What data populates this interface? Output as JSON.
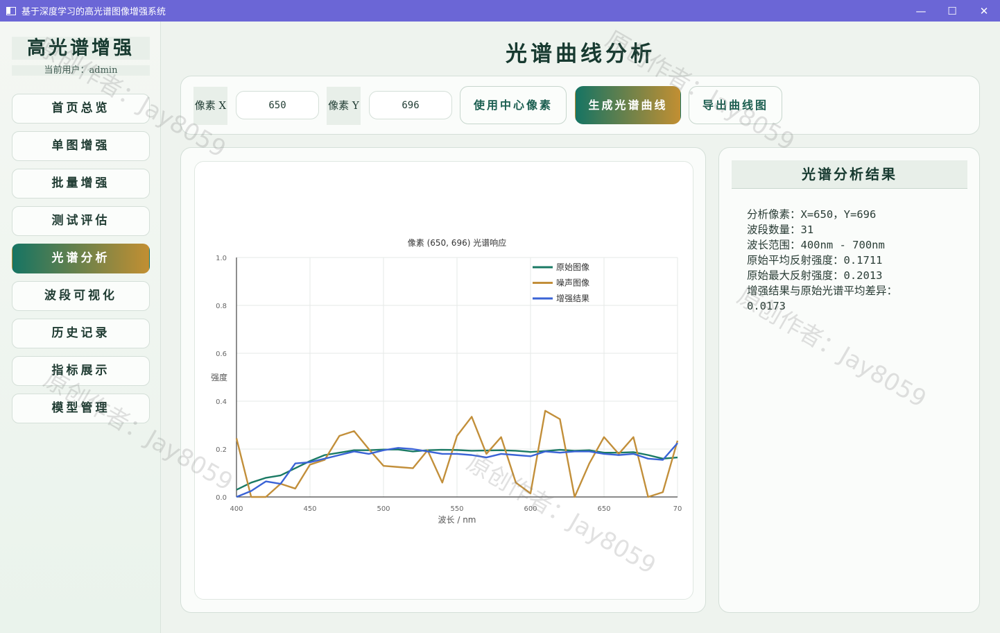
{
  "window": {
    "title": "基于深度学习的高光谱图像增强系统",
    "minimize": "—",
    "maximize": "☐",
    "close": "✕"
  },
  "sidebar": {
    "brand": "高光谱增强",
    "user": "当前用户：admin",
    "items": [
      {
        "label": "首页总览",
        "active": false
      },
      {
        "label": "单图增强",
        "active": false
      },
      {
        "label": "批量增强",
        "active": false
      },
      {
        "label": "测试评估",
        "active": false
      },
      {
        "label": "光谱分析",
        "active": true
      },
      {
        "label": "波段可视化",
        "active": false
      },
      {
        "label": "历史记录",
        "active": false
      },
      {
        "label": "指标展示",
        "active": false
      },
      {
        "label": "模型管理",
        "active": false
      }
    ]
  },
  "page": {
    "title": "光谱曲线分析"
  },
  "toolbar": {
    "x_label": "像素 X",
    "x_value": "650",
    "y_label": "像素 Y",
    "y_value": "696",
    "center_button": "使用中心像素",
    "generate_button": "生成光谱曲线",
    "export_button": "导出曲线图"
  },
  "results": {
    "title": "光谱分析结果",
    "text": "分析像素：X=650，Y=696\n波段数量：31\n波长范围：400nm - 700nm\n原始平均反射强度：0.1711\n原始最大反射强度：0.2013\n增强结果与原始光谱平均差异：\n0.0173"
  },
  "watermark": "原创作者：Jay8059",
  "colors": {
    "original": "#1a7a64",
    "noisy": "#c28f3a",
    "enhanced": "#3a63d6",
    "accent_start": "#167463",
    "accent_end": "#c28f32"
  },
  "chart_data": {
    "type": "line",
    "title": "像素 (650, 696) 光谱响应",
    "xlabel": "波长 / nm",
    "ylabel": "强度",
    "xlim": [
      400,
      700
    ],
    "ylim": [
      0,
      1.0
    ],
    "xticks": [
      "400",
      "450",
      "500",
      "550",
      "600",
      "650",
      "70"
    ],
    "yticks": [
      "0.0",
      "0.2",
      "0.4",
      "0.6",
      "0.8",
      "1.0"
    ],
    "grid": true,
    "legend": "top-right",
    "x": [
      400,
      410,
      420,
      430,
      440,
      450,
      460,
      470,
      480,
      490,
      500,
      510,
      520,
      530,
      540,
      550,
      560,
      570,
      580,
      590,
      600,
      610,
      620,
      630,
      640,
      650,
      660,
      670,
      680,
      690,
      700
    ],
    "series": [
      {
        "name": "原始图像",
        "color": "#1a7a64",
        "values": [
          0.03,
          0.06,
          0.08,
          0.09,
          0.12,
          0.15,
          0.175,
          0.185,
          0.195,
          0.195,
          0.198,
          0.198,
          0.19,
          0.195,
          0.197,
          0.196,
          0.193,
          0.194,
          0.195,
          0.193,
          0.188,
          0.192,
          0.197,
          0.193,
          0.195,
          0.185,
          0.185,
          0.187,
          0.175,
          0.16,
          0.165
        ]
      },
      {
        "name": "噪声图像",
        "color": "#c28f3a",
        "values": [
          0.245,
          0.0,
          0.0,
          0.055,
          0.035,
          0.135,
          0.155,
          0.255,
          0.275,
          0.2,
          0.13,
          0.125,
          0.12,
          0.195,
          0.06,
          0.255,
          0.335,
          0.18,
          0.25,
          0.06,
          0.015,
          0.36,
          0.325,
          0.0,
          0.14,
          0.25,
          0.18,
          0.25,
          0.0,
          0.02,
          0.235
        ]
      },
      {
        "name": "增强结果",
        "color": "#3a63d6",
        "values": [
          0.0,
          0.025,
          0.065,
          0.055,
          0.14,
          0.145,
          0.16,
          0.175,
          0.19,
          0.18,
          0.195,
          0.205,
          0.2,
          0.19,
          0.18,
          0.18,
          0.175,
          0.165,
          0.18,
          0.175,
          0.17,
          0.19,
          0.185,
          0.19,
          0.19,
          0.18,
          0.175,
          0.18,
          0.16,
          0.155,
          0.225
        ]
      }
    ]
  }
}
